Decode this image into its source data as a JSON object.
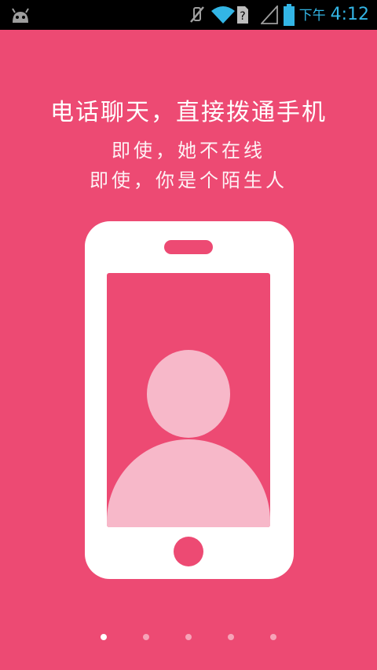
{
  "status_bar": {
    "time_prefix": "下午",
    "time": "4:12",
    "icons": [
      "android-icon",
      "mute-icon",
      "wifi-icon",
      "unknown-sim-icon",
      "signal-icon",
      "battery-icon"
    ],
    "icon_color": "#33b5e5"
  },
  "intro": {
    "headline": "电话聊天，直接拨通手机",
    "line1": "即使，她不在线",
    "line2": "即使，你是个陌生人"
  },
  "pager": {
    "total": 5,
    "active_index": 0
  },
  "colors": {
    "background": "#ed4a73",
    "phone": "#ffffff",
    "avatar": "#f7b8c9",
    "dot_active": "#ffffff",
    "dot_inactive": "#f6a3b8"
  }
}
